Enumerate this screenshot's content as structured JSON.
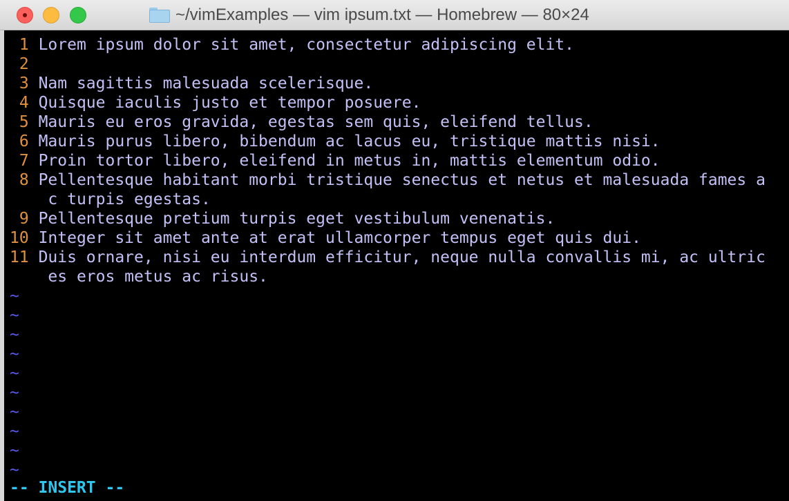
{
  "window": {
    "title": "~/vimExamples — vim ipsum.txt — Homebrew — 80×24"
  },
  "editor": {
    "lines": [
      {
        "num": " 1",
        "text": "Lorem ipsum dolor sit amet, consectetur adipiscing elit."
      },
      {
        "num": " 2",
        "text": ""
      },
      {
        "num": " 3",
        "text": "Nam sagittis malesuada scelerisque."
      },
      {
        "num": " 4",
        "text": "Quisque iaculis justo et tempor posuere."
      },
      {
        "num": " 5",
        "text": "Mauris eu eros gravida, egestas sem quis, eleifend tellus."
      },
      {
        "num": " 6",
        "text": "Mauris purus libero, bibendum ac lacus eu, tristique mattis nisi."
      },
      {
        "num": " 7",
        "text": "Proin tortor libero, eleifend in metus in, mattis elementum odio."
      },
      {
        "num": " 8",
        "text": "Pellentesque habitant morbi tristique senectus et netus et malesuada fames a"
      },
      {
        "num": "   ",
        "text": "c turpis egestas."
      },
      {
        "num": " 9",
        "text": "Pellentesque pretium turpis eget vestibulum venenatis."
      },
      {
        "num": "10",
        "text": "Integer sit amet ante at erat ullamcorper tempus eget quis dui."
      },
      {
        "num": "11",
        "text": "Duis ornare, nisi eu interdum efficitur, neque nulla convallis mi, ac ultric"
      },
      {
        "num": "   ",
        "text": "es eros metus ac risus."
      }
    ],
    "tilde": "~",
    "status": "-- INSERT --"
  },
  "colors": {
    "line_number": "#e0913f",
    "text": "#c3c0f6",
    "tilde": "#5b57ee",
    "status": "#2fc7f0",
    "background": "#000000"
  }
}
